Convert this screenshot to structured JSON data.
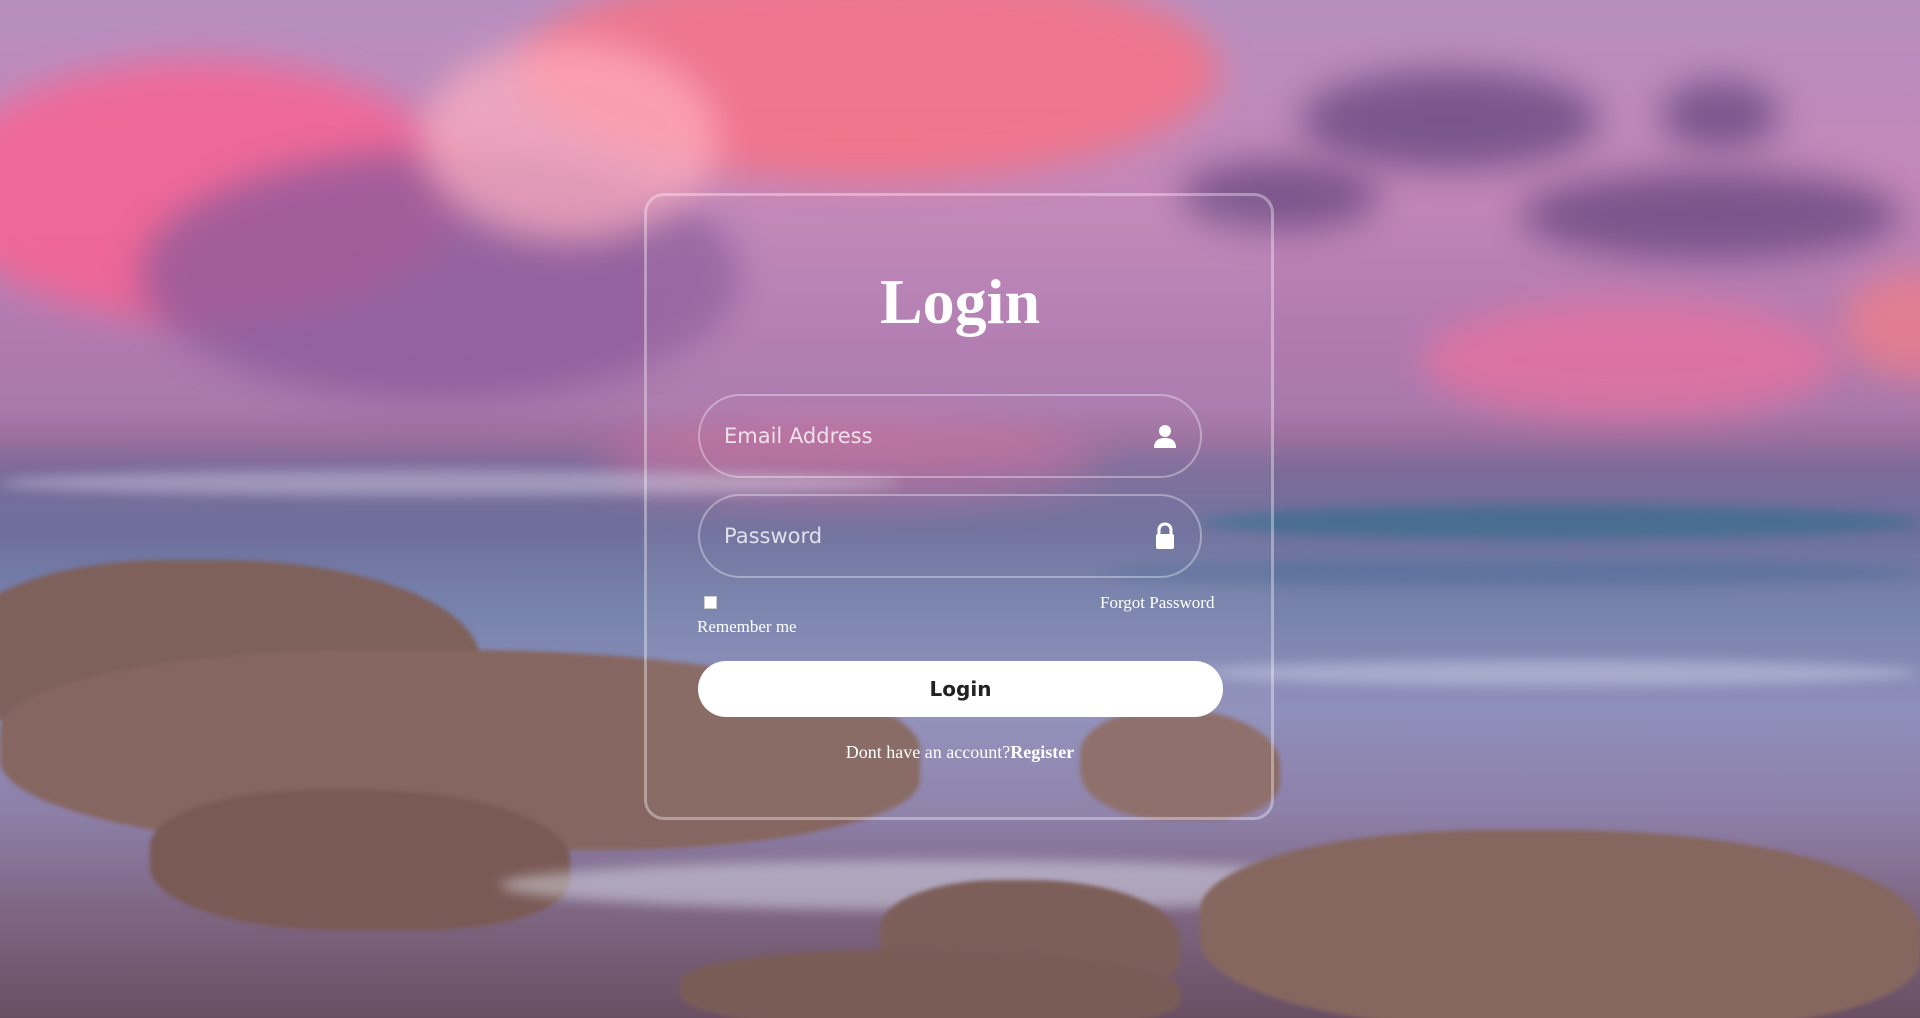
{
  "login": {
    "title": "Login",
    "email_placeholder": "Email Address",
    "password_placeholder": "Password",
    "remember_label": "Remember me",
    "forgot_link": "Forgot Password",
    "submit_label": "Login",
    "register_prompt": "Dont have an account?",
    "register_link": "Register",
    "remember_checked": false
  },
  "icons": {
    "email": "user-icon",
    "password": "lock-icon"
  },
  "colors": {
    "text": "#ffffff",
    "button_bg": "#ffffff",
    "button_text": "#222222"
  }
}
